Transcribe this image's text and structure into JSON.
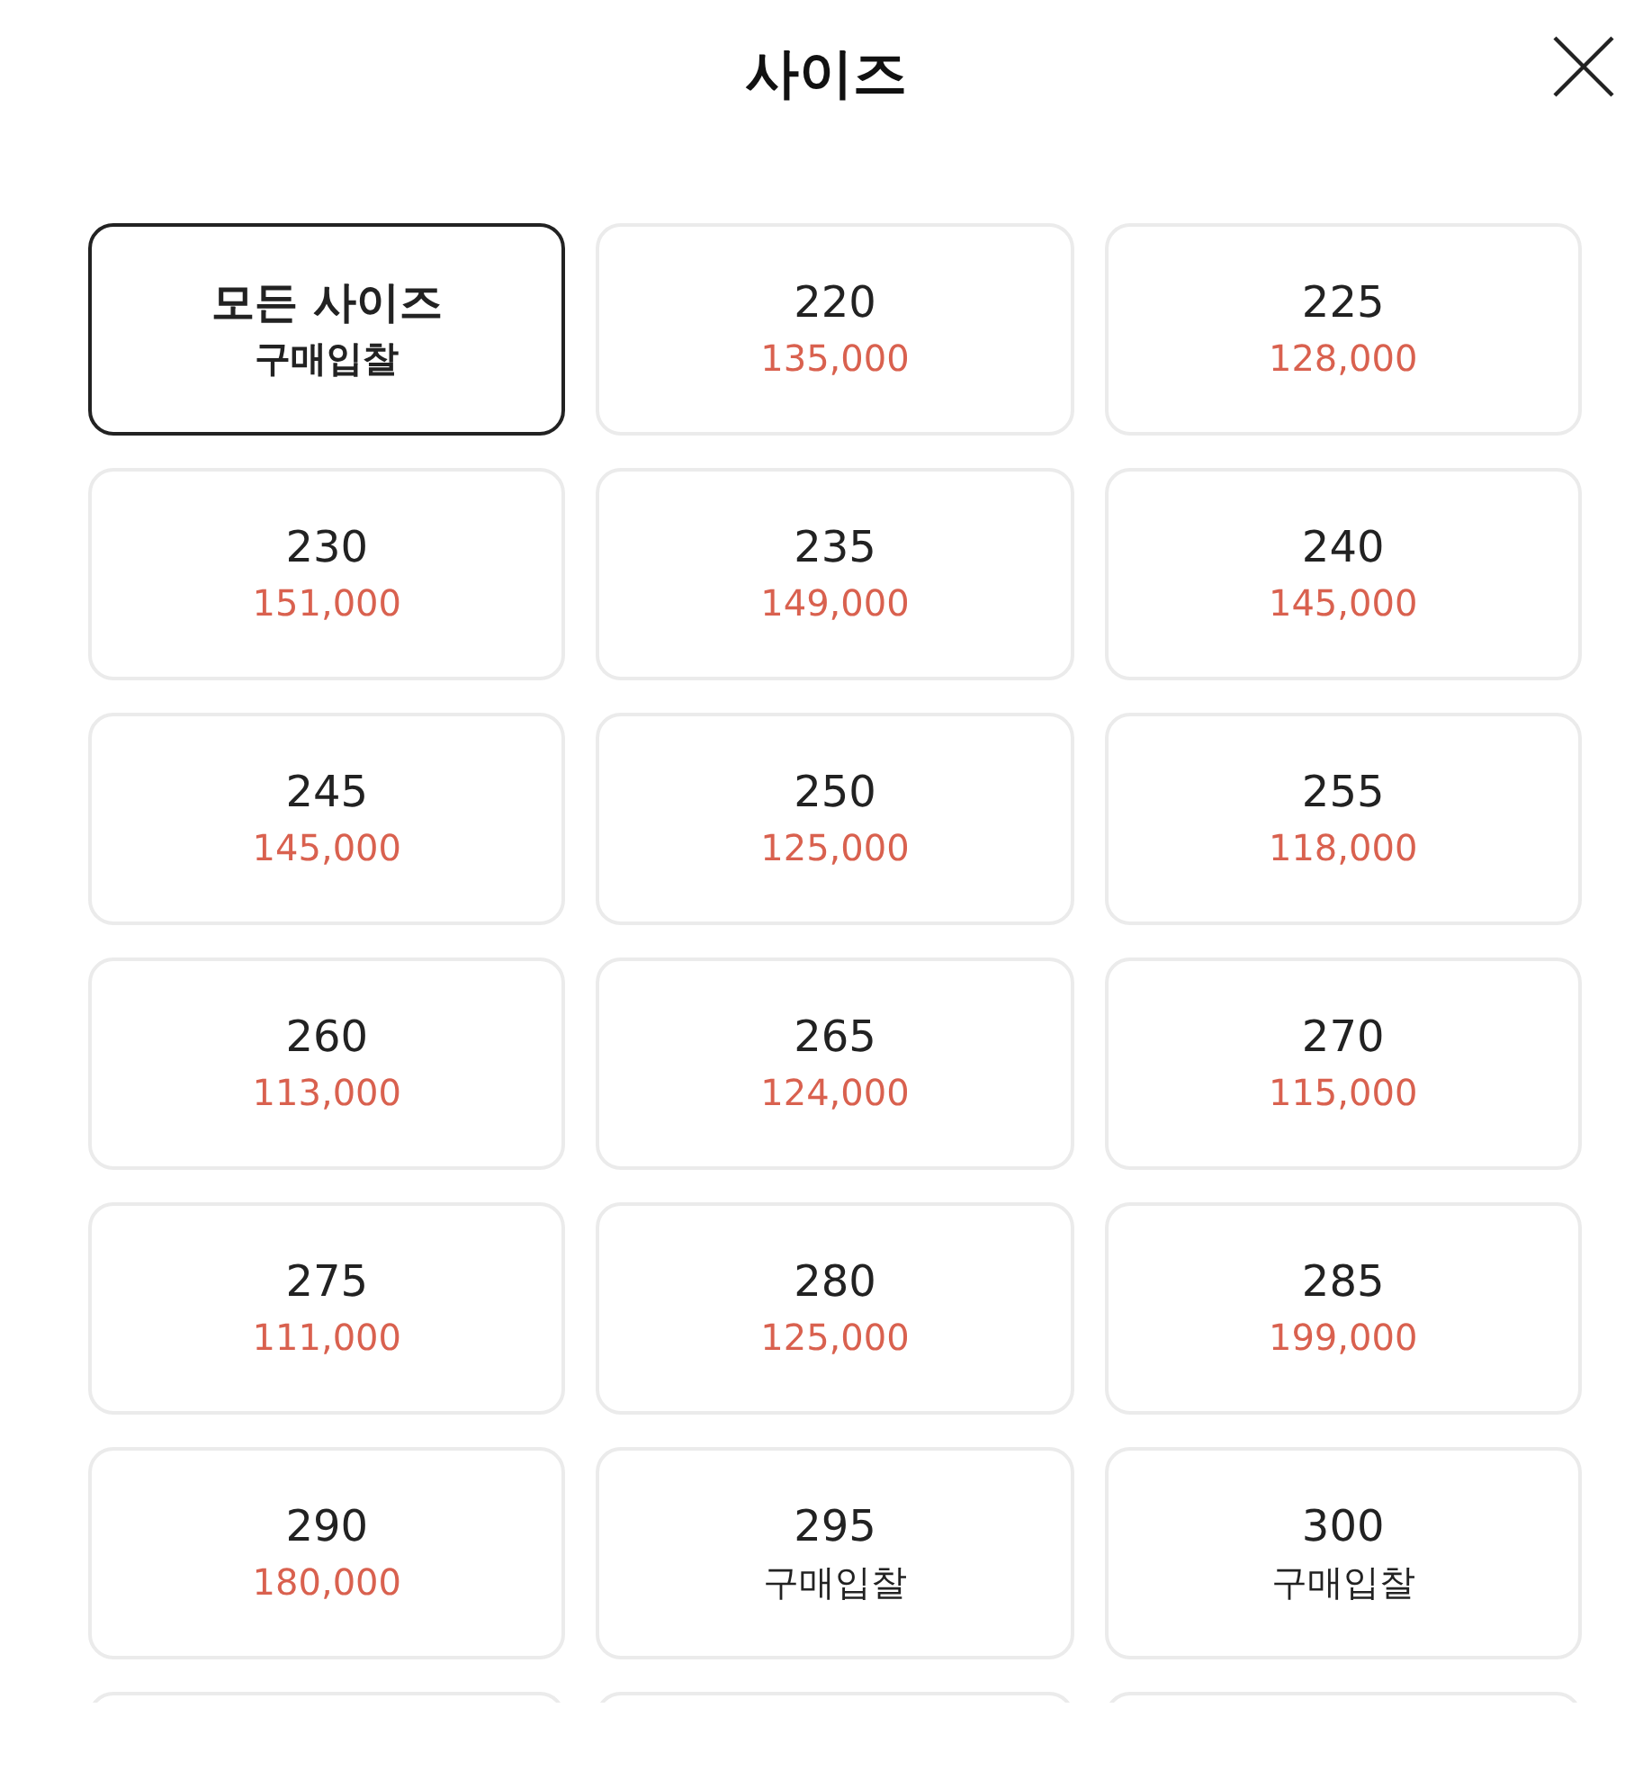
{
  "title": "사이즈",
  "options": [
    {
      "size": "모든 사이즈",
      "sub": "구매입찰",
      "kind": "bid",
      "selected": true
    },
    {
      "size": "220",
      "sub": "135,000",
      "kind": "price",
      "selected": false
    },
    {
      "size": "225",
      "sub": "128,000",
      "kind": "price",
      "selected": false
    },
    {
      "size": "230",
      "sub": "151,000",
      "kind": "price",
      "selected": false
    },
    {
      "size": "235",
      "sub": "149,000",
      "kind": "price",
      "selected": false
    },
    {
      "size": "240",
      "sub": "145,000",
      "kind": "price",
      "selected": false
    },
    {
      "size": "245",
      "sub": "145,000",
      "kind": "price",
      "selected": false
    },
    {
      "size": "250",
      "sub": "125,000",
      "kind": "price",
      "selected": false
    },
    {
      "size": "255",
      "sub": "118,000",
      "kind": "price",
      "selected": false
    },
    {
      "size": "260",
      "sub": "113,000",
      "kind": "price",
      "selected": false
    },
    {
      "size": "265",
      "sub": "124,000",
      "kind": "price",
      "selected": false
    },
    {
      "size": "270",
      "sub": "115,000",
      "kind": "price",
      "selected": false
    },
    {
      "size": "275",
      "sub": "111,000",
      "kind": "price",
      "selected": false
    },
    {
      "size": "280",
      "sub": "125,000",
      "kind": "price",
      "selected": false
    },
    {
      "size": "285",
      "sub": "199,000",
      "kind": "price",
      "selected": false
    },
    {
      "size": "290",
      "sub": "180,000",
      "kind": "price",
      "selected": false
    },
    {
      "size": "295",
      "sub": "구매입찰",
      "kind": "bid",
      "selected": false
    },
    {
      "size": "300",
      "sub": "구매입찰",
      "kind": "bid",
      "selected": false
    }
  ]
}
